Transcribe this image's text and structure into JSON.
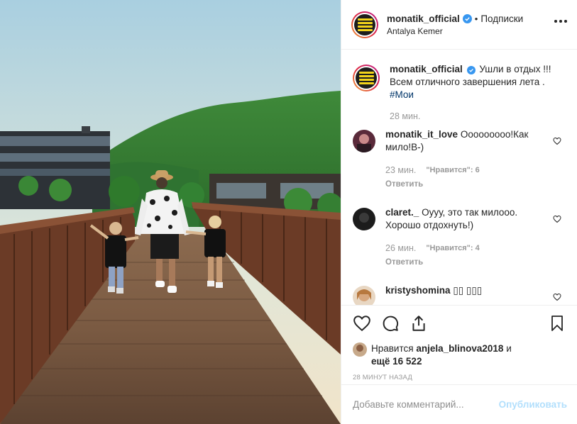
{
  "post": {
    "author": "monatik_official",
    "follow_label": "Подписки",
    "separator": "•",
    "location": "Antalya Kemer"
  },
  "caption": {
    "author": "monatik_official",
    "text": "Ушли в отдых !!! Всем отличного завершения лета .",
    "hashtag": "#Мои",
    "time": "28 мин."
  },
  "comments": [
    {
      "user": "monatik_it_love",
      "text": "Ооооооооо!Как мило!В-)",
      "time": "23 мин.",
      "likes": "\"Нравится\": 6",
      "reply": "Ответить"
    },
    {
      "user": "claret._",
      "text": "Оууу, это так милооо. Хорошо отдохнуть!)",
      "time": "26 мин.",
      "likes": "\"Нравится\": 4",
      "reply": "Ответить"
    },
    {
      "user": "kristyshomina",
      "text": "▯▯ ▯▯▯",
      "time": "",
      "likes": "",
      "reply": ""
    }
  ],
  "likes": {
    "prefix": "Нравится",
    "user": "anjela_blinova2018",
    "middle": "и",
    "count_text": "ещё 16 522"
  },
  "posted_time": "28 МИНУТ НАЗАД",
  "comment_box": {
    "placeholder": "Добавьте комментарий...",
    "publish_label": "Опубликовать"
  },
  "icons": {
    "verified": "verified-badge-icon",
    "more": "more-options-icon",
    "like": "heart-icon",
    "comment": "comment-icon",
    "share": "share-icon",
    "save": "bookmark-icon"
  },
  "colors": {
    "verified": "#3897f0",
    "hashtag": "#003569",
    "muted": "#999999",
    "publish_disabled": "#b2dffc"
  }
}
